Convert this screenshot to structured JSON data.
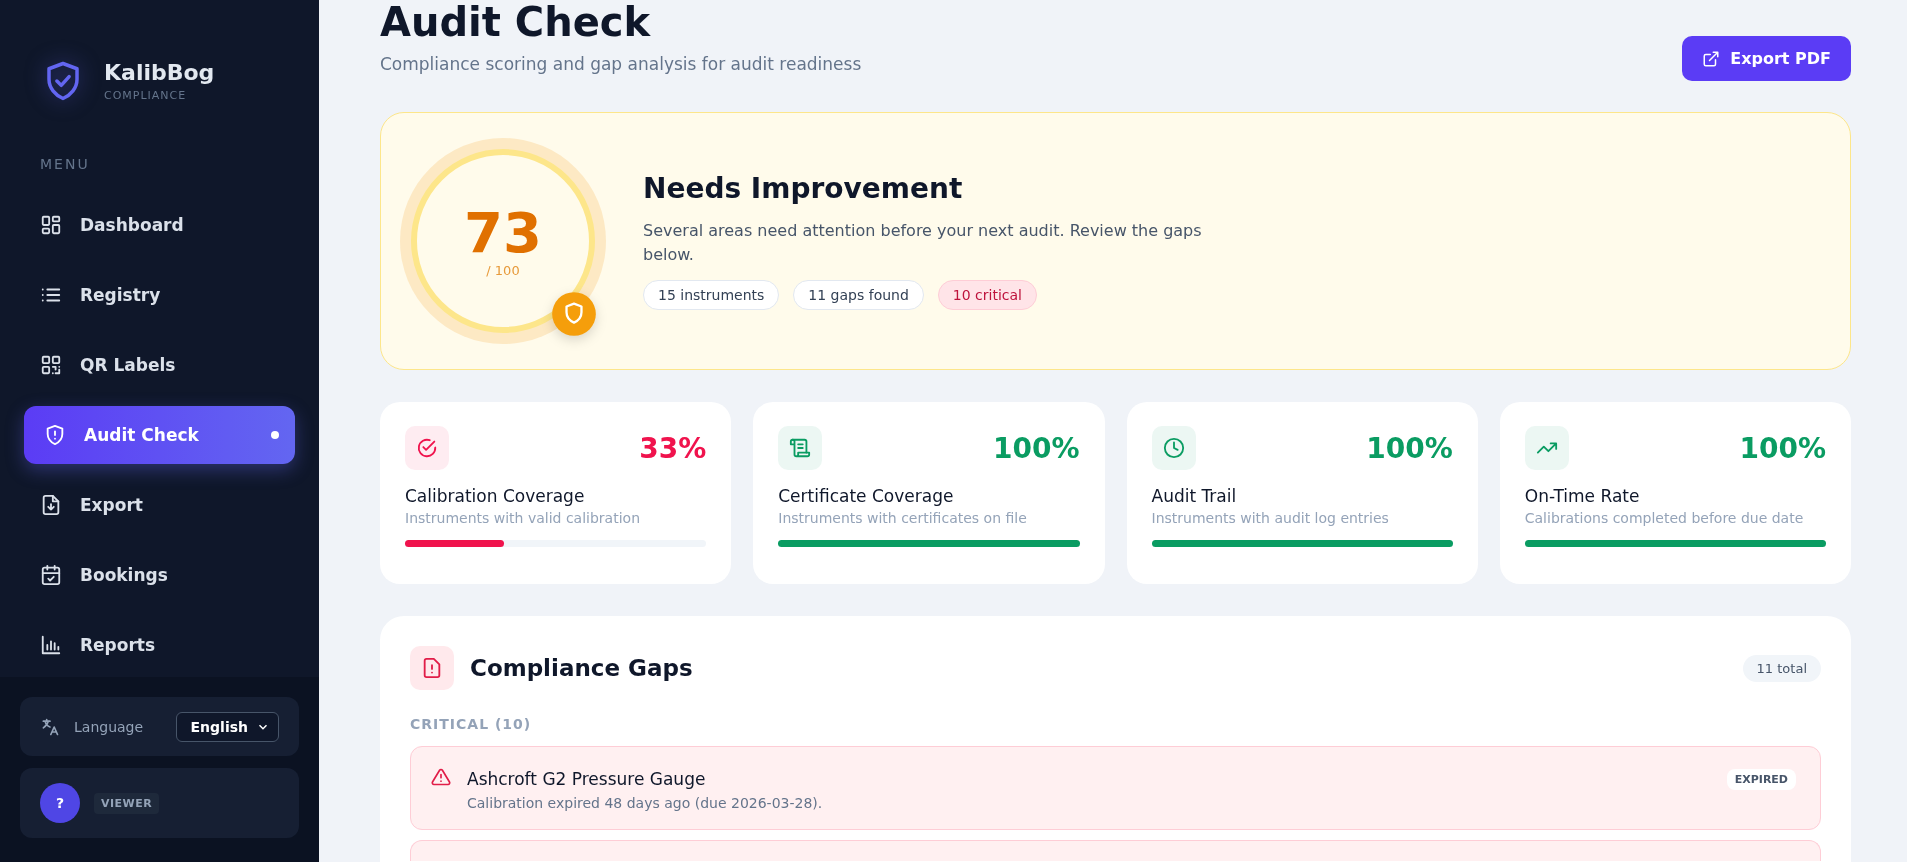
{
  "brand": {
    "name": "KalibBog",
    "tagline": "COMPLIANCE"
  },
  "menu": {
    "heading": "MENU",
    "items": [
      {
        "label": "Dashboard",
        "kind": "dashboard",
        "selected": false
      },
      {
        "label": "Registry",
        "kind": "list",
        "selected": false
      },
      {
        "label": "QR Labels",
        "kind": "qr",
        "selected": false
      },
      {
        "label": "Audit Check",
        "kind": "shield",
        "selected": true
      },
      {
        "label": "Export",
        "kind": "export",
        "selected": false
      },
      {
        "label": "Bookings",
        "kind": "calendar",
        "selected": false
      },
      {
        "label": "Reports",
        "kind": "chart",
        "selected": false
      }
    ]
  },
  "language": {
    "label": "Language",
    "value": "English"
  },
  "user": {
    "avatar": "?",
    "role": "VIEWER"
  },
  "header": {
    "title": "Audit Check",
    "subtitle": "Compliance scoring and gap analysis for audit readiness",
    "export_button": "Export PDF"
  },
  "score": {
    "value": "73",
    "max": "/ 100",
    "heading": "Needs Improvement",
    "description": "Several areas need attention before your next audit. Review the gaps below.",
    "chips": [
      {
        "label": "15 instruments",
        "kind": "neutral"
      },
      {
        "label": "11 gaps found",
        "kind": "neutral"
      },
      {
        "label": "10 critical",
        "kind": "critical"
      }
    ]
  },
  "metrics": [
    {
      "kind": "check",
      "value": "33%",
      "title": "Calibration Coverage",
      "description": "Instruments with valid calibration",
      "level": 0.33,
      "color": "#f0134d"
    },
    {
      "kind": "scroll",
      "value": "100%",
      "title": "Certificate Coverage",
      "description": "Instruments with certificates on file",
      "level": 1,
      "color": "#0a9c62"
    },
    {
      "kind": "clock",
      "value": "100%",
      "title": "Audit Trail",
      "description": "Instruments with audit log entries",
      "level": 1,
      "color": "#0a9c62"
    },
    {
      "kind": "trend",
      "value": "100%",
      "title": "On-Time Rate",
      "description": "Calibrations completed before due date",
      "level": 1,
      "color": "#0a9c62"
    }
  ],
  "gaps": {
    "title": "Compliance Gaps",
    "total": "11 total",
    "group": "CRITICAL (10)",
    "items": [
      {
        "title": "Ashcroft G2 Pressure Gauge",
        "detail": "Calibration expired 48 days ago (due 2026-03-28).",
        "badge": "EXPIRED",
        "kind": "critical"
      }
    ]
  }
}
